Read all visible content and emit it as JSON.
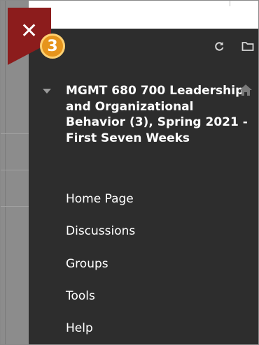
{
  "close_button": {
    "icon": "close-icon",
    "glyph": "✕"
  },
  "step_badge": "3",
  "controls": {
    "refresh_icon": "refresh-icon",
    "folder_icon": "folder-icon"
  },
  "course": {
    "title": "MGMT 680 700 Leadership and Organizational Behavior (3), Spring 2021 - First Seven Weeks",
    "home_icon": "home-icon"
  },
  "menu": {
    "items": [
      {
        "label": "Home Page"
      },
      {
        "label": "Discussions"
      },
      {
        "label": "Groups"
      },
      {
        "label": "Tools"
      },
      {
        "label": "Help"
      }
    ]
  },
  "colors": {
    "panel": "#2d2d2d",
    "close_red": "#8c1c1c",
    "badge_orange": "#e6941c",
    "text": "#ffffff"
  }
}
